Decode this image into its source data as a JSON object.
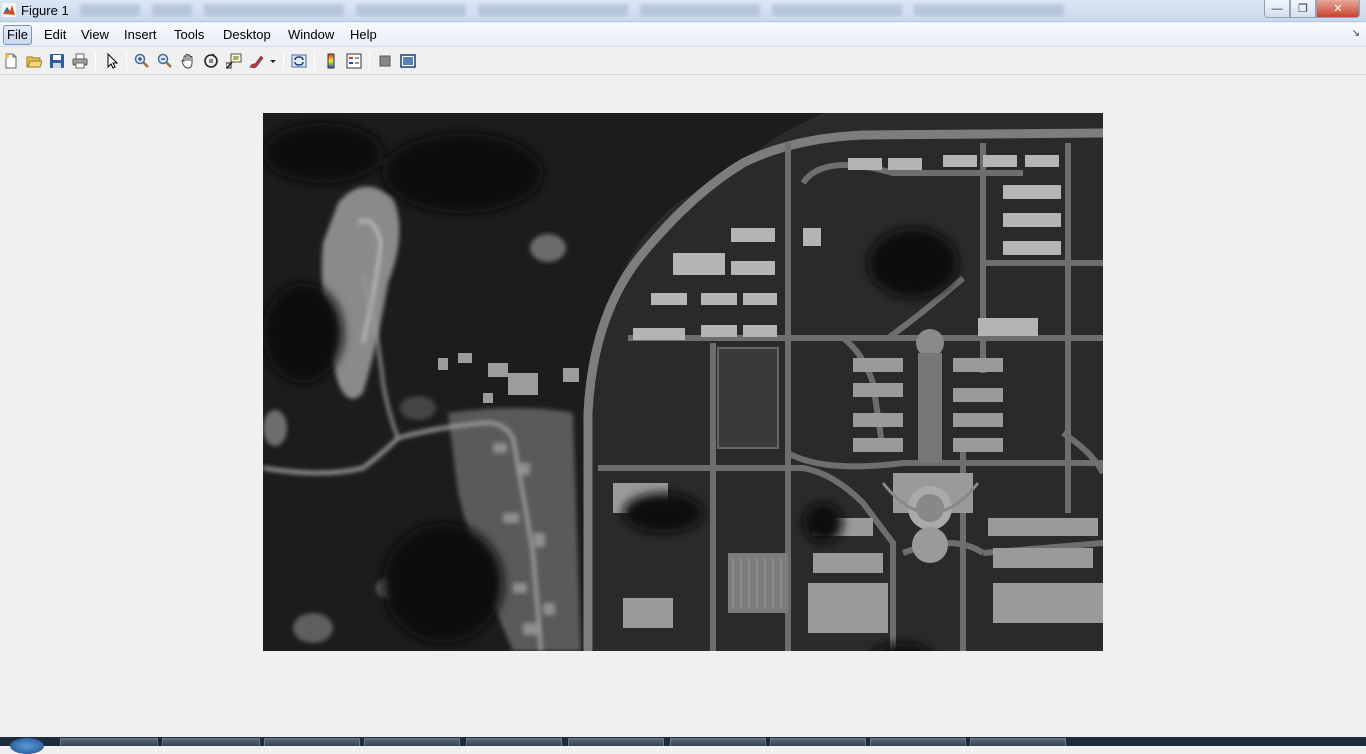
{
  "window": {
    "title": "Figure 1",
    "controls": {
      "minimize": "—",
      "maximize": "❐",
      "close": "✕"
    }
  },
  "menu": {
    "items": [
      {
        "label": "File",
        "name": "menu-file",
        "active": true
      },
      {
        "label": "Edit",
        "name": "menu-edit"
      },
      {
        "label": "View",
        "name": "menu-view"
      },
      {
        "label": "Insert",
        "name": "menu-insert"
      },
      {
        "label": "Tools",
        "name": "menu-tools"
      },
      {
        "label": "Desktop",
        "name": "menu-desktop"
      },
      {
        "label": "Window",
        "name": "menu-window"
      },
      {
        "label": "Help",
        "name": "menu-help"
      }
    ],
    "dock_arrow": "↘"
  },
  "toolbar": {
    "buttons": [
      {
        "icon": "new-figure-icon"
      },
      {
        "icon": "open-file-icon"
      },
      {
        "icon": "save-figure-icon"
      },
      {
        "icon": "print-figure-icon"
      },
      {
        "icon": "edit-plot-arrow-icon"
      },
      {
        "icon": "zoom-in-icon"
      },
      {
        "icon": "zoom-out-icon"
      },
      {
        "icon": "pan-hand-icon"
      },
      {
        "icon": "rotate-3d-icon"
      },
      {
        "icon": "data-cursor-icon"
      },
      {
        "icon": "brush-icon"
      },
      {
        "icon": "link-plot-icon"
      },
      {
        "icon": "insert-colorbar-icon"
      },
      {
        "icon": "insert-legend-icon"
      },
      {
        "icon": "hide-plot-tools-icon"
      },
      {
        "icon": "show-plot-tools-icon"
      }
    ]
  },
  "figure": {
    "content": "grayscale aerial image",
    "colors": {
      "background": "#f0f0f0",
      "image_dark": "#1a1a1a"
    }
  }
}
